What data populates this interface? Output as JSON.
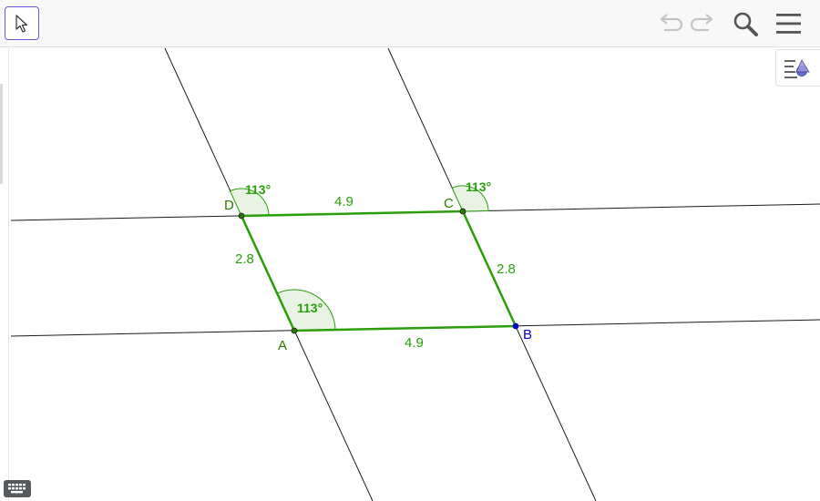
{
  "toolbar": {
    "tool_icon": "move-arrow-icon",
    "undo_icon": "undo-icon",
    "redo_icon": "redo-icon",
    "search_icon": "search-icon",
    "menu_icon": "hamburger-menu-icon"
  },
  "style_bar_icon": "style-bar-toggle-icon",
  "keyboard_icon": "keyboard-icon",
  "colors": {
    "accent": "#6557d2",
    "polygon": "#2a9e0a",
    "angle_fill": "#e8f3e3",
    "point_A": "#2a7a00",
    "point_B": "#0000cc",
    "line": "#1a1a1a"
  },
  "geometry": {
    "points": {
      "A": "A",
      "B": "B",
      "C": "C",
      "D": "D"
    },
    "sides": {
      "AB": "4.9",
      "BC": "2.8",
      "CD": "4.9",
      "DA": "2.8"
    },
    "angles": {
      "A": "113°",
      "C": "113°",
      "D": "113°"
    }
  }
}
